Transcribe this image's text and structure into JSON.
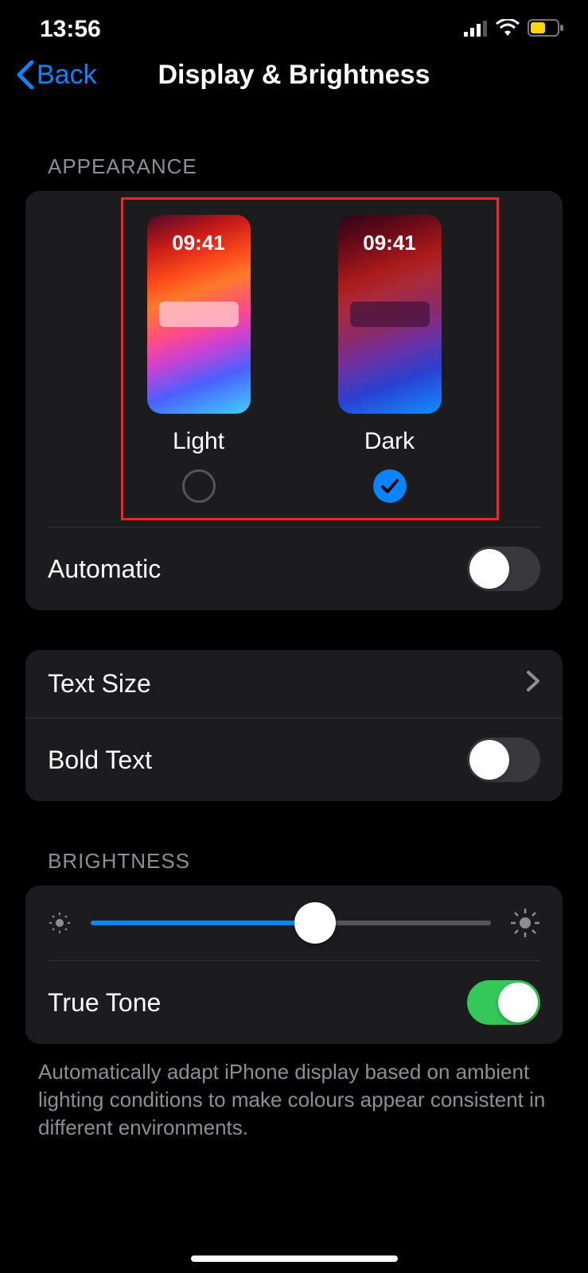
{
  "status": {
    "time": "13:56"
  },
  "nav": {
    "back": "Back",
    "title": "Display & Brightness"
  },
  "sections": {
    "appearance": {
      "header": "APPEARANCE",
      "options": {
        "light": {
          "label": "Light",
          "preview_time": "09:41",
          "selected": false
        },
        "dark": {
          "label": "Dark",
          "preview_time": "09:41",
          "selected": true
        }
      },
      "automatic": {
        "label": "Automatic",
        "value": false
      }
    },
    "text": {
      "text_size": {
        "label": "Text Size"
      },
      "bold_text": {
        "label": "Bold Text",
        "value": false
      }
    },
    "brightness": {
      "header": "BRIGHTNESS",
      "slider_percent": 56,
      "true_tone": {
        "label": "True Tone",
        "value": true
      },
      "footer": "Automatically adapt iPhone display based on ambient lighting conditions to make colours appear consistent in different environments."
    }
  }
}
